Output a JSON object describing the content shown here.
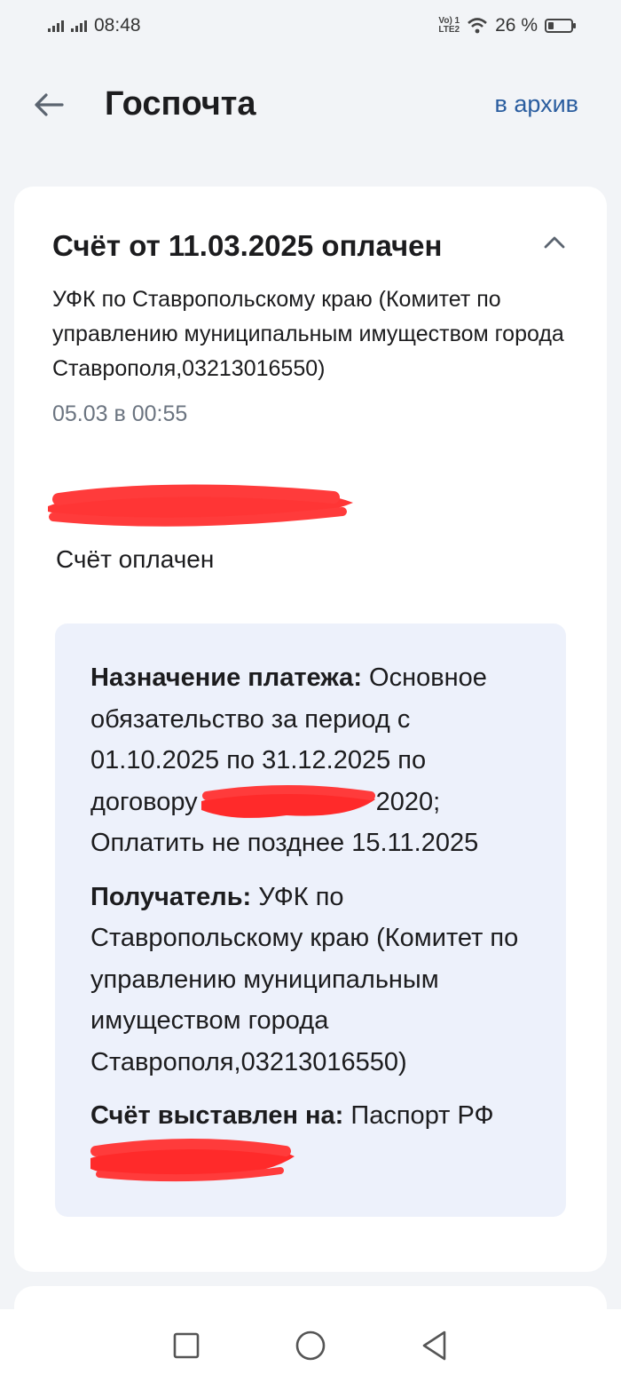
{
  "status_bar": {
    "time": "08:48",
    "network_label": "Vo) 1\nLTE2",
    "battery": "26 %"
  },
  "header": {
    "title": "Госпочта",
    "archive_label": "в архив"
  },
  "card": {
    "title": "Счёт от 11.03.2025 оплачен",
    "organization": "УФК по Ставропольскому краю (Комитет по управлению муниципальным имуществом города Ставрополя,03213016550)",
    "datetime": "05.03 в 00:55",
    "status_text": "Счёт оплачен",
    "details": {
      "purpose_label": "Назначение платежа:",
      "purpose_value_1": " Основное обязательство за период с 01.10.2025 по 31.12.2025 по договору",
      "purpose_value_2": "2020; Оплатить не позднее 15.11.2025",
      "recipient_label": "Получатель:",
      "recipient_value": " УФК по Ставропольскому краю (Комитет по управлению муниципальным имуществом города Ставрополя,03213016550)",
      "issued_label": "Счёт выставлен на:",
      "issued_value": " Паспорт РФ"
    }
  },
  "colors": {
    "accent": "#2a5d9f",
    "details_bg": "#edf1fb",
    "redaction": "#ff2a2a"
  }
}
